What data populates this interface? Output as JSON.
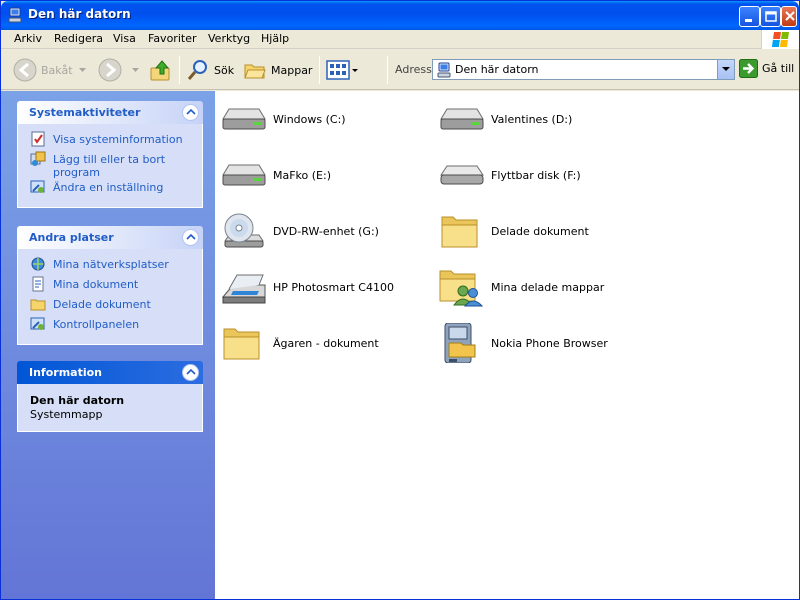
{
  "window": {
    "title": "Den här datorn"
  },
  "menu": [
    "Arkiv",
    "Redigera",
    "Visa",
    "Favoriter",
    "Verktyg",
    "Hjälp"
  ],
  "toolbar": {
    "back_label": "Bakåt",
    "search_label": "Sök",
    "folders_label": "Mappar",
    "address_label": "Adress",
    "address_value": "Den här datorn",
    "go_label": "Gå till"
  },
  "tasks": {
    "title": "Systemaktiviteter",
    "items": [
      "Visa systeminformation",
      "Lägg till eller ta bort program",
      "Ändra en inställning"
    ]
  },
  "places": {
    "title": "Andra platser",
    "items": [
      "Mina nätverksplatser",
      "Mina dokument",
      "Delade dokument",
      "Kontrollpanelen"
    ]
  },
  "info": {
    "title": "Information",
    "name": "Den här datorn",
    "type": "Systemmapp"
  },
  "items": [
    {
      "name": "Windows (C:)",
      "icon": "hard-drive-icon"
    },
    {
      "name": "Valentines (D:)",
      "icon": "hard-drive-icon"
    },
    {
      "name": "MaFko (E:)",
      "icon": "hard-drive-icon"
    },
    {
      "name": "Flyttbar disk (F:)",
      "icon": "removable-disk-icon"
    },
    {
      "name": "DVD-RW-enhet (G:)",
      "icon": "dvd-drive-icon"
    },
    {
      "name": "Delade dokument",
      "icon": "folder-icon"
    },
    {
      "name": "HP Photosmart C4100",
      "icon": "scanner-icon"
    },
    {
      "name": "Mina delade mappar",
      "icon": "shared-folder-icon"
    },
    {
      "name": "Ägaren - dokument",
      "icon": "folder-icon"
    },
    {
      "name": "Nokia Phone Browser",
      "icon": "phone-browser-icon"
    }
  ]
}
